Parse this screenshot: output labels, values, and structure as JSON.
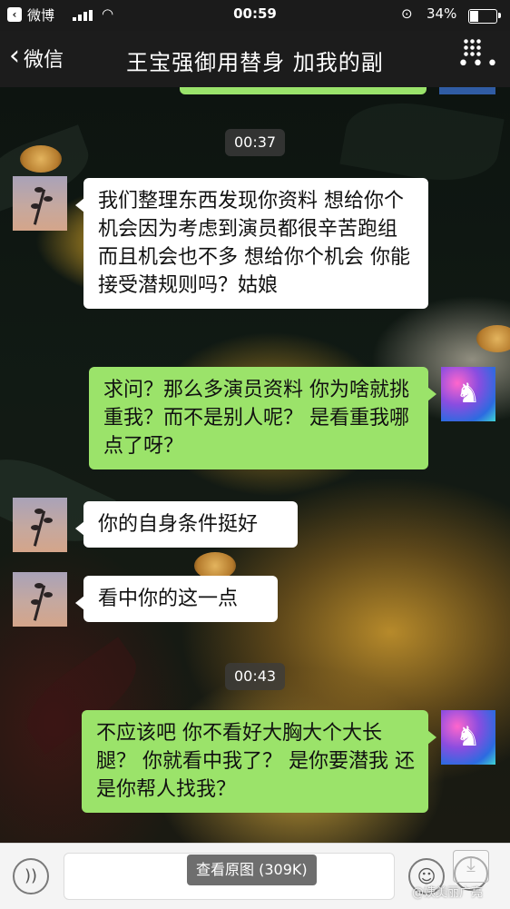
{
  "status_bar": {
    "back_app": "微博",
    "time": "00:59",
    "battery_percent": "34%",
    "battery_level": 0.34
  },
  "nav": {
    "back_label": "微信",
    "title": "王宝强御用替身 加我的副"
  },
  "messages": [
    {
      "type": "timestamp",
      "text": "00:37"
    },
    {
      "type": "incoming",
      "text": "我们整理东西发现你资料  想给你个机会因为考虑到演员都很辛苦跑组 而且机会也不多 想给你个机会  你能接受潜规则吗？姑娘"
    },
    {
      "type": "outgoing",
      "text": "求问？那么多演员资料 你为啥就挑重我？而不是别人呢？ 是看重我哪点了呀？"
    },
    {
      "type": "incoming",
      "text": "你的自身条件挺好"
    },
    {
      "type": "incoming",
      "text": "看中你的这一点"
    },
    {
      "type": "timestamp",
      "text": "00:43"
    },
    {
      "type": "outgoing",
      "text": "不应该吧 你不看好大胸大个大长腿？ 你就看中我了？ 是你要潜我 还是你帮人找我？"
    }
  ],
  "input_bar": {
    "view_original_label": "查看原图 (309K)"
  },
  "watermark": "@姨美丽广亮",
  "colors": {
    "incoming_bubble": "#ffffff",
    "outgoing_bubble": "#9be36a",
    "nav_bg": "#1c1c1c"
  }
}
